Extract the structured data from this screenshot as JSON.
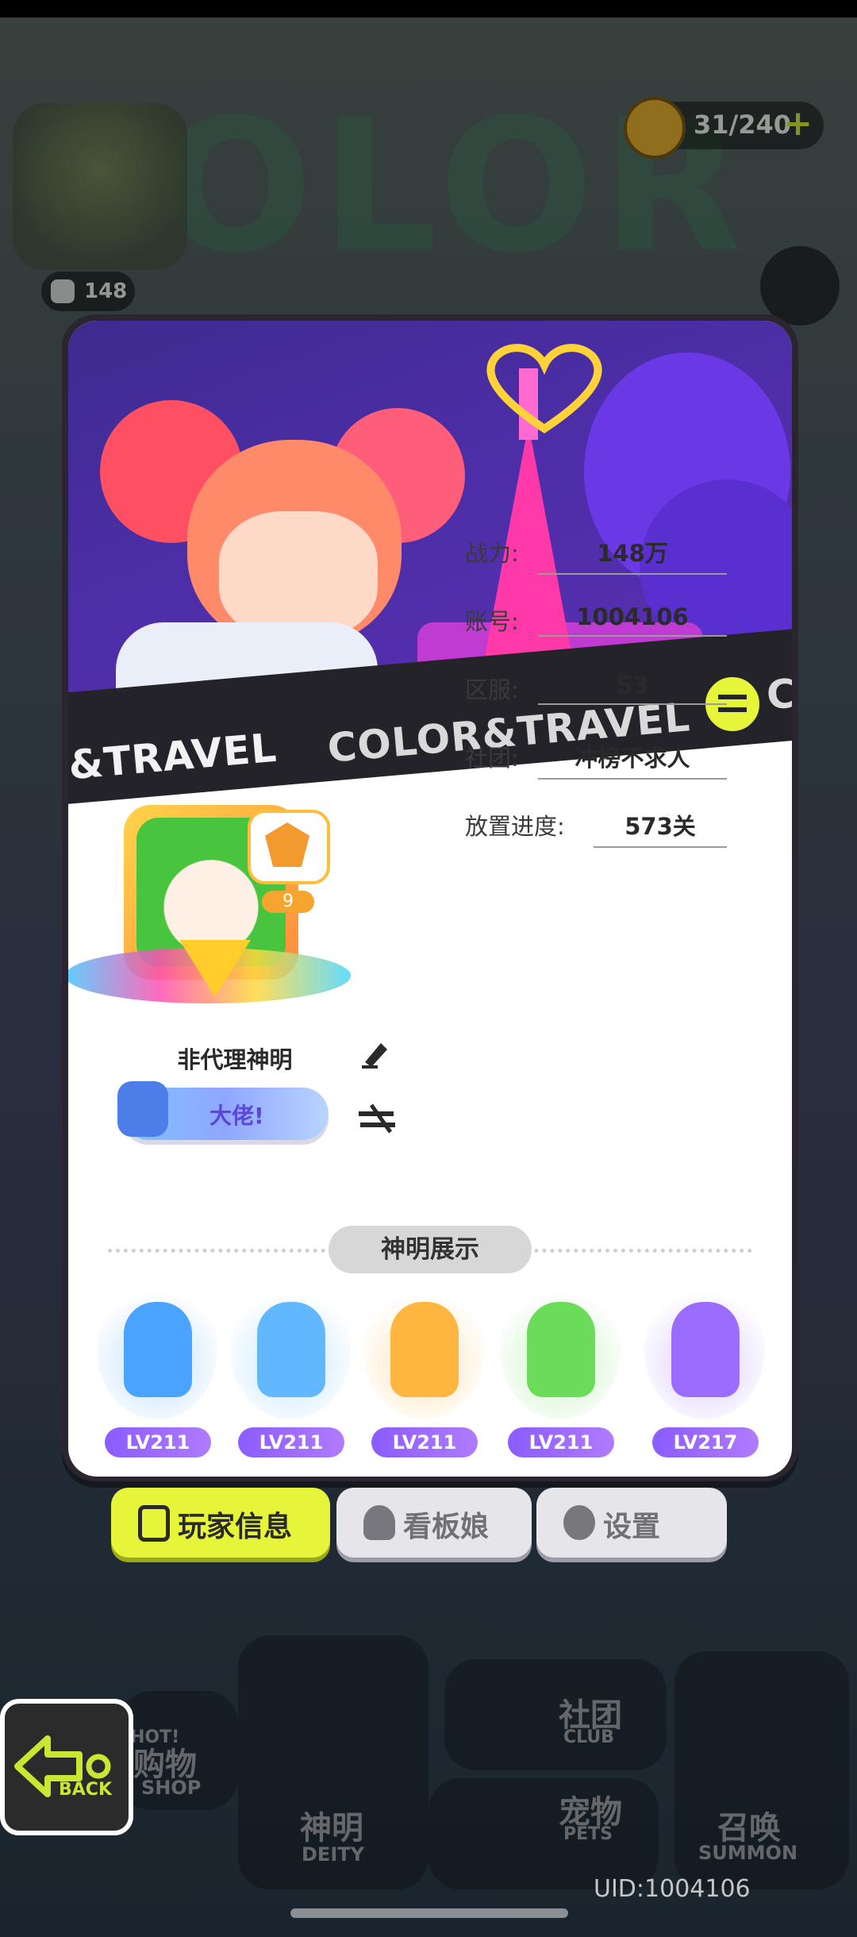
{
  "hud": {
    "coins": "31/240",
    "coins_plus": "+",
    "power_short": "148"
  },
  "banner": {
    "strip_left": "&TRAVEL",
    "strip_main": "COLOR&TRAVEL",
    "strip_right": "CO"
  },
  "profile": {
    "nickname": "非代理神明",
    "rank_level": "9",
    "likes_label": "大佬!",
    "fields": [
      {
        "label": "战力:",
        "value": "148万"
      },
      {
        "label": "账号:",
        "value": "1004106"
      },
      {
        "label": "区服:",
        "value": "S3"
      },
      {
        "label": "社团:",
        "value": "冲榜不求人"
      },
      {
        "label": "放置进度:",
        "value": "573关"
      }
    ]
  },
  "deity_showcase": {
    "title": "神明展示",
    "deities": [
      {
        "level": "LV211",
        "color": "#4aa3ff"
      },
      {
        "level": "LV211",
        "color": "#62b8ff"
      },
      {
        "level": "LV211",
        "color": "#ffb640"
      },
      {
        "level": "LV211",
        "color": "#6bdc5a"
      },
      {
        "level": "LV217",
        "color": "#9b6cff"
      }
    ]
  },
  "tabs": [
    {
      "label": "玩家信息",
      "active": true
    },
    {
      "label": "看板娘",
      "active": false
    },
    {
      "label": "设置",
      "active": false
    }
  ],
  "bottom_menu": {
    "shop": "购物",
    "shop_en": "SHOP",
    "hot": "HOT!",
    "deity": "神明",
    "deity_en": "DEITY",
    "club": "社团",
    "club_en": "CLUB",
    "pets": "宠物",
    "pets_en": "PETS",
    "summon": "召唤",
    "summon_en": "SUMMON",
    "back": "BACK"
  },
  "uid": "UID:1004106"
}
